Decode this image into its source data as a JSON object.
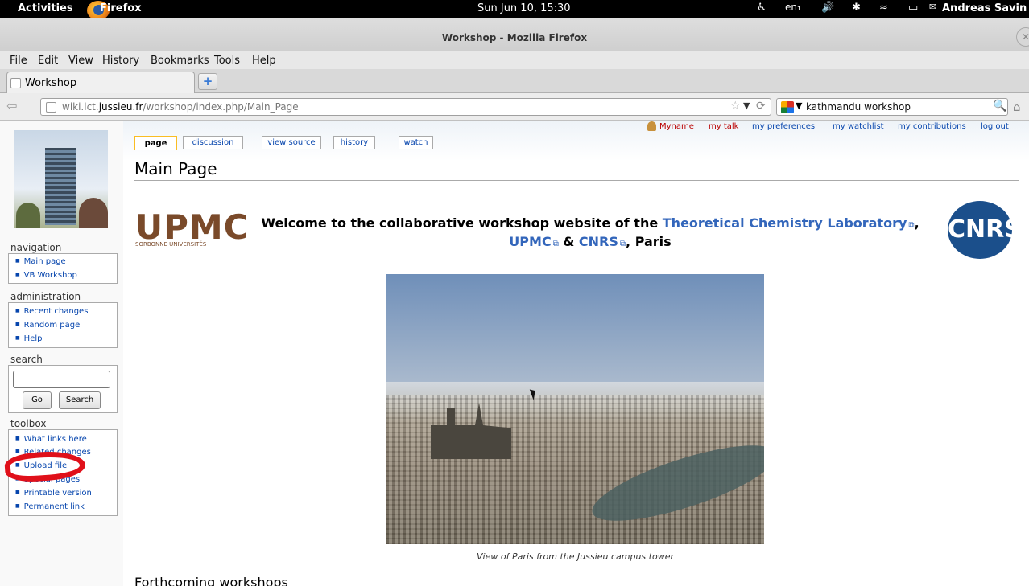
{
  "system_bar": {
    "activities": "Activities",
    "app_name": "Firefox",
    "clock": "Sun Jun 10, 15:30",
    "keyboard": "en₁",
    "user": "Andreas Savin"
  },
  "window": {
    "title": "Workshop - Mozilla Firefox"
  },
  "menu": [
    "File",
    "Edit",
    "View",
    "History",
    "Bookmarks",
    "Tools",
    "Help"
  ],
  "tab": {
    "label": "Workshop"
  },
  "nav": {
    "url_host_pre": "wiki.lct.",
    "url_host_bold": "jussieu.fr",
    "url_path": "/workshop/index.php/Main_Page",
    "search_value": "kathmandu workshop"
  },
  "personal_tools": {
    "username": "Myname",
    "talk": "my talk",
    "preferences": "my preferences",
    "watchlist": "my watchlist",
    "contributions": "my contributions",
    "logout": "log out"
  },
  "page_tabs": {
    "page": "page",
    "discussion": "discussion",
    "view_source": "view source",
    "history": "history",
    "watch": "watch"
  },
  "sidebar": {
    "navigation_heading": "navigation",
    "navigation": [
      "Main page",
      "VB Workshop"
    ],
    "administration_heading": "administration",
    "administration": [
      "Recent changes",
      "Random page",
      "Help"
    ],
    "search_heading": "search",
    "go_label": "Go",
    "search_label": "Search",
    "toolbox_heading": "toolbox",
    "toolbox": [
      "What links here",
      "Related changes",
      "Upload file",
      "Special pages",
      "Printable version",
      "Permanent link"
    ]
  },
  "content": {
    "title": "Main Page",
    "upmc_logo": "UPMC",
    "upmc_sub": "SORBONNE UNIVERSITÉS",
    "welcome_pre": "Welcome to the collaborative workshop website of the ",
    "welcome_link1": "Theoretical Chemistry Laboratory",
    "welcome_sep1": ",",
    "welcome_link2": "UPMC",
    "welcome_amp": " & ",
    "welcome_link3": "CNRS",
    "welcome_post": ", Paris",
    "cnrs_logo": "CNRS",
    "photo_caption": "View of Paris from the Jussieu campus tower",
    "section_heading": "Forthcoming workshops"
  }
}
